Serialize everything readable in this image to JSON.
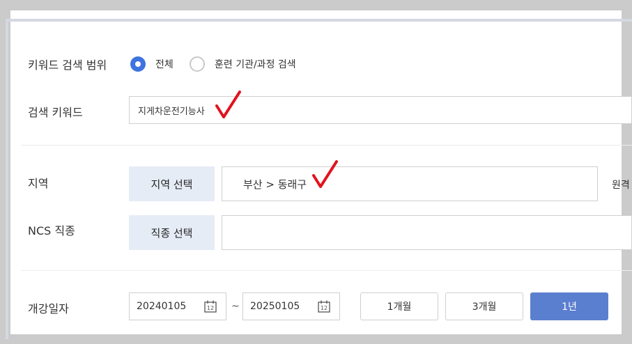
{
  "keyword_scope": {
    "label": "키워드 검색 범위",
    "options": [
      {
        "label": "전체",
        "checked": true
      },
      {
        "label": "훈련 기관/과정 검색",
        "checked": false
      }
    ]
  },
  "search_keyword": {
    "label": "검색 키워드",
    "value": "지게차운전기능사"
  },
  "region": {
    "label": "지역",
    "button_label": "지역 선택",
    "value": "부산 > 동래구",
    "trailing_text": "원격"
  },
  "ncs": {
    "label": "NCS 직종",
    "button_label": "직종 선택",
    "value": ""
  },
  "open_date": {
    "label": "개강일자",
    "start": "20240105",
    "separator": "~",
    "end": "20250105",
    "calendar_day": "12",
    "periods": [
      {
        "label": "1개월",
        "active": false
      },
      {
        "label": "3개월",
        "active": false
      },
      {
        "label": "1년",
        "active": true
      }
    ]
  },
  "colors": {
    "accent": "#3f74de",
    "active_button": "#5b7fcf",
    "select_button_bg": "#e6ecf6",
    "annotation_check": "#e0141e"
  },
  "icons": [
    "calendar-icon",
    "check-mark-annotation"
  ]
}
